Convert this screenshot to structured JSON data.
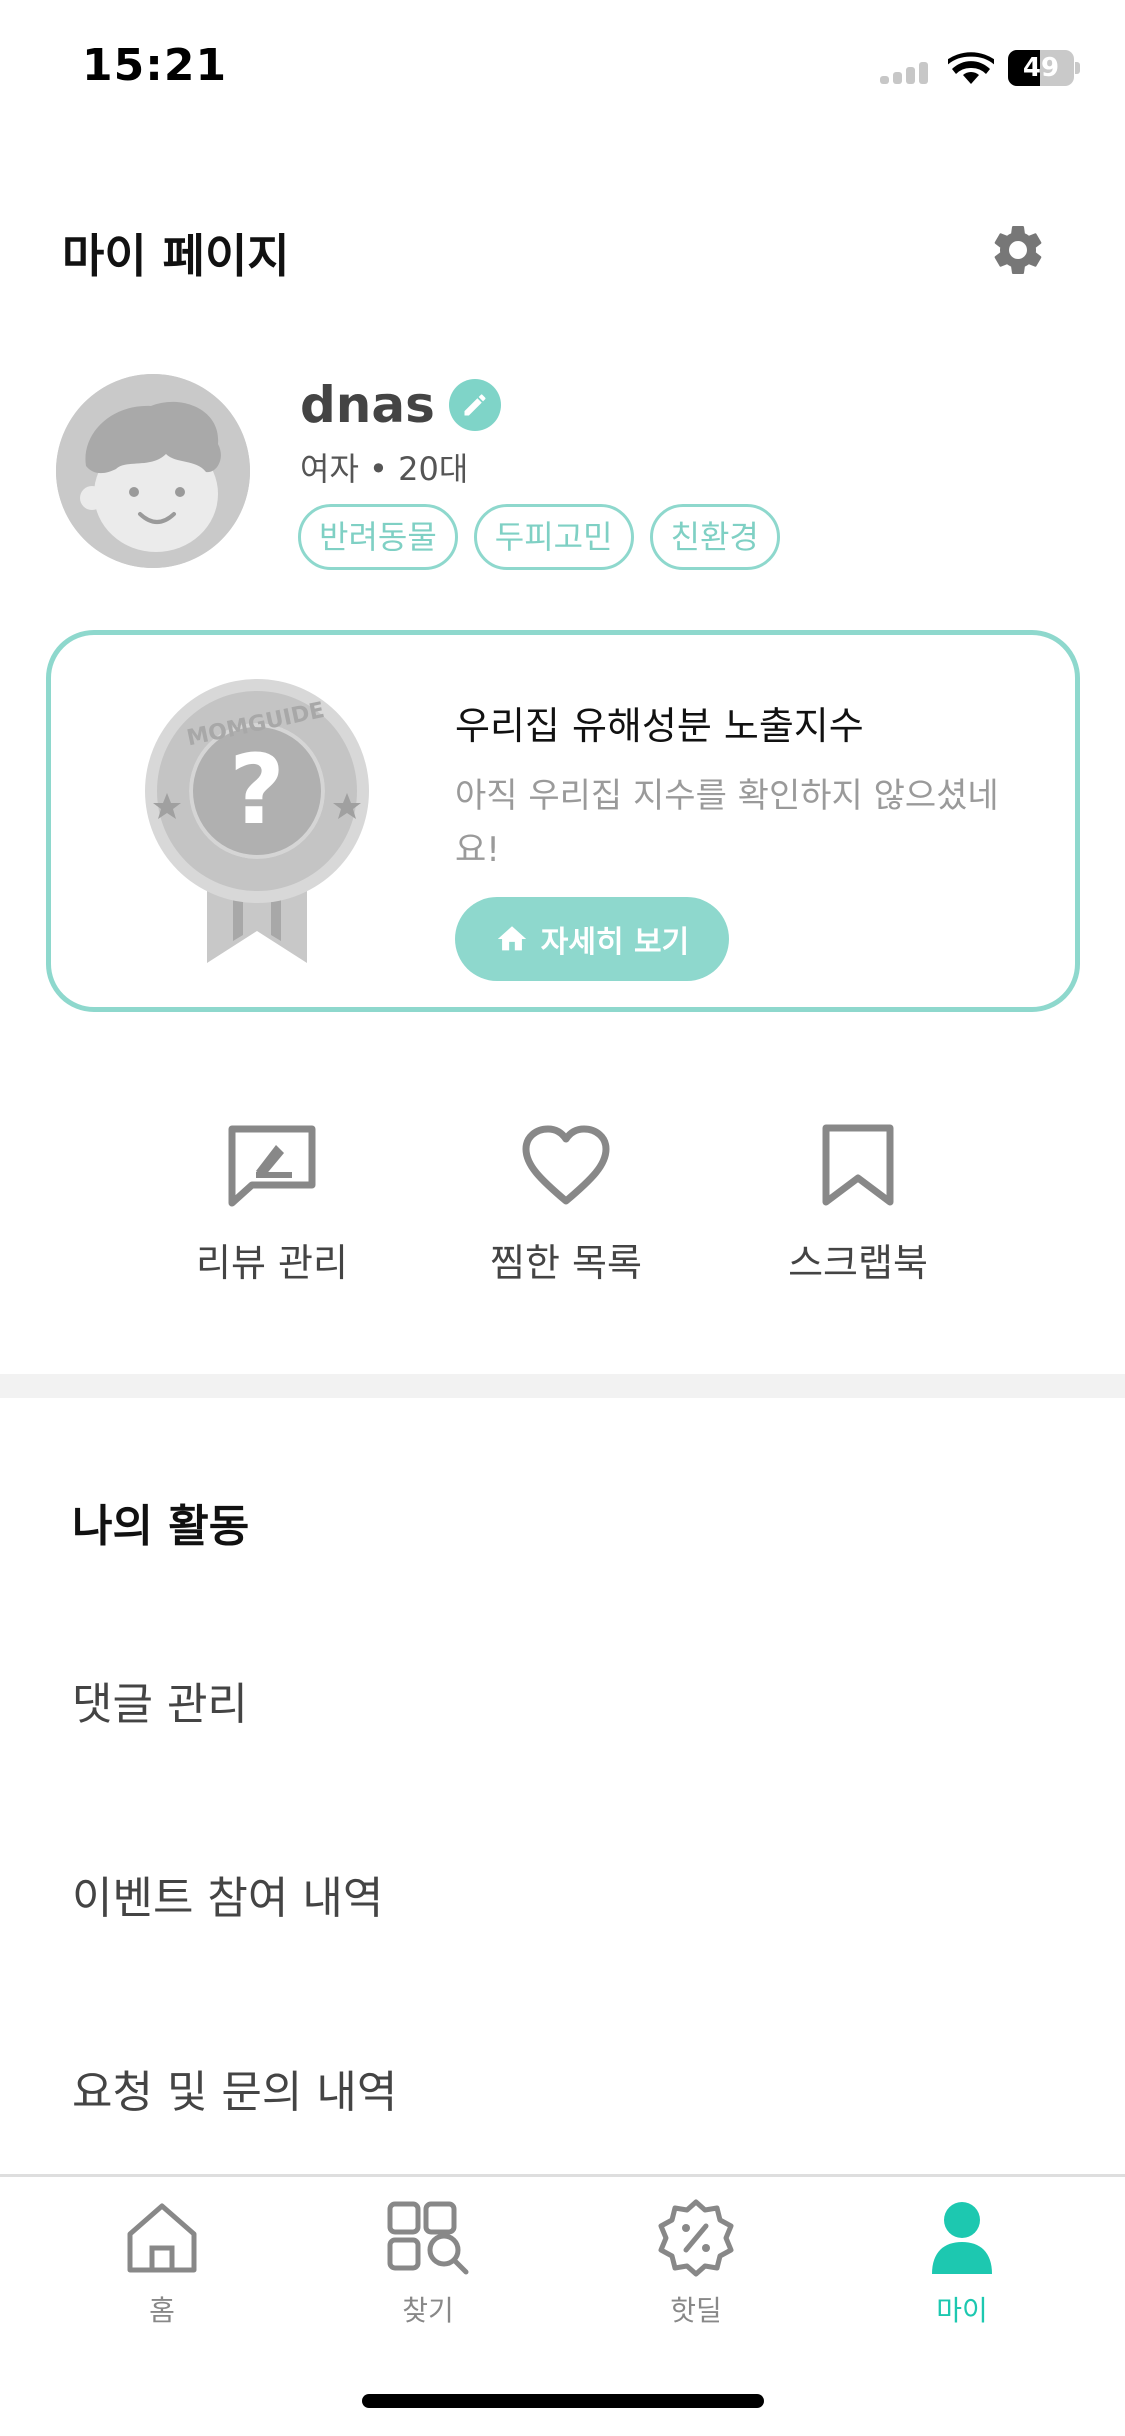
{
  "status_bar": {
    "time": "15:21",
    "battery_percent": "49",
    "battery_level": 0.49
  },
  "header": {
    "title": "마이 페이지"
  },
  "profile": {
    "username": "dnas",
    "meta": "여자 • 20대",
    "tags": [
      "반려동물",
      "두피고민",
      "친환경"
    ]
  },
  "exposure_card": {
    "title": "우리집 유해성분 노출지수",
    "description": "아직 우리집 지수를 확인하지 않으셨네요!",
    "button_label": "자세히 보기",
    "medal_text": "MOMGUIDE"
  },
  "quick_actions": [
    {
      "label": "리뷰 관리",
      "icon": "review-icon"
    },
    {
      "label": "찜한 목록",
      "icon": "heart-icon"
    },
    {
      "label": "스크랩북",
      "icon": "bookmark-icon"
    }
  ],
  "activity": {
    "title": "나의 활동",
    "items": [
      "댓글 관리",
      "이벤트 참여 내역",
      "요청 및 문의 내역"
    ]
  },
  "bottom_nav": {
    "items": [
      {
        "label": "홈",
        "icon": "home-icon"
      },
      {
        "label": "찾기",
        "icon": "search-grid-icon"
      },
      {
        "label": "핫딜",
        "icon": "discount-badge-icon"
      },
      {
        "label": "마이",
        "icon": "person-icon",
        "active": true
      }
    ],
    "active_color": "#1dc8b0"
  },
  "colors": {
    "accent": "#8ed8cd",
    "accent_text": "#7fd0c4",
    "active_nav": "#1dc8b0"
  }
}
